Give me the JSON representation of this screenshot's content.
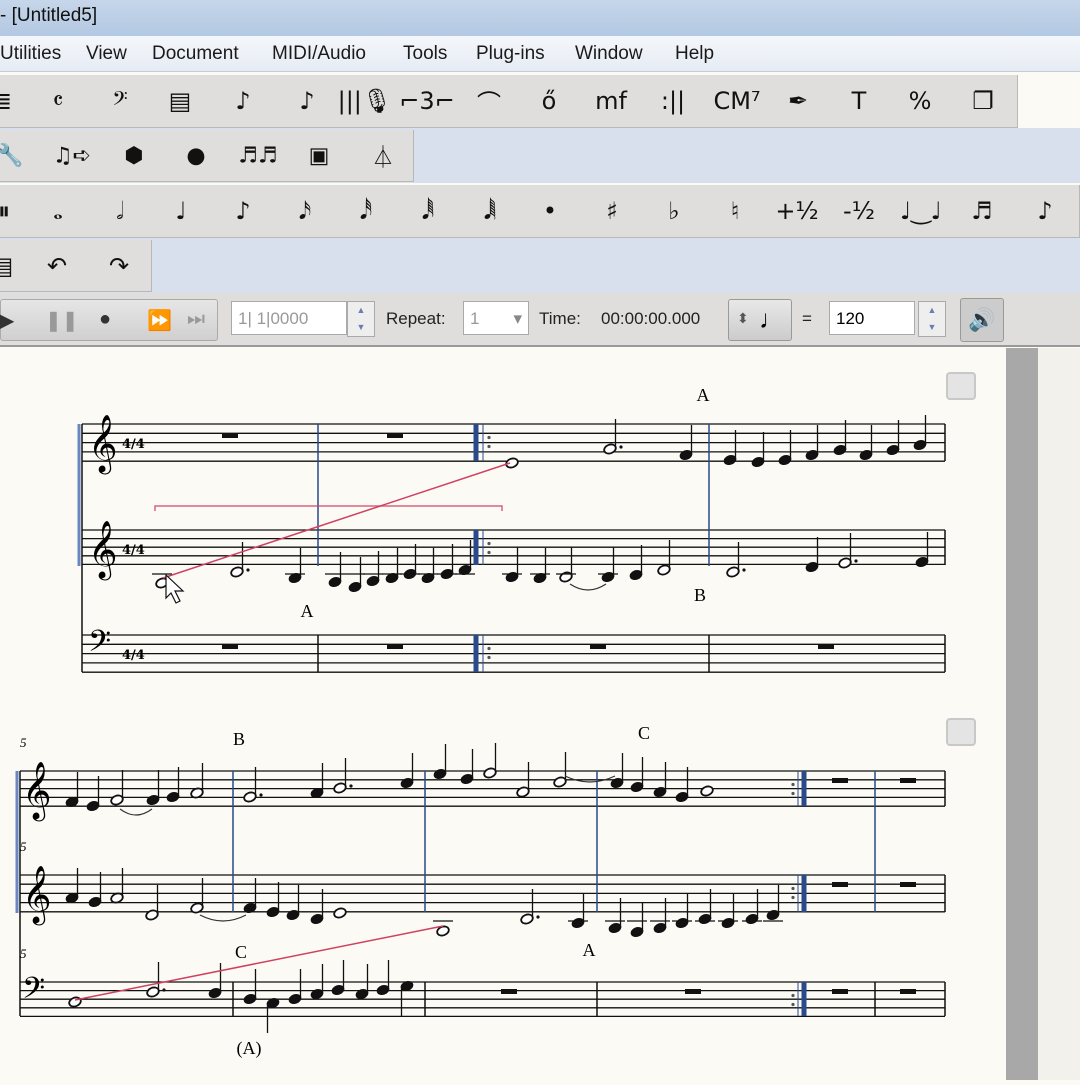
{
  "window": {
    "title": "- [Untitled5]"
  },
  "menu": [
    "Utilities",
    "View",
    "Document",
    "MIDI/Audio",
    "Tools",
    "Plug-ins",
    "Window",
    "Help"
  ],
  "toolbar_main": [
    {
      "name": "staff-tool-icon",
      "glyph": "≣"
    },
    {
      "name": "time-signature-icon",
      "glyph": "𝄴"
    },
    {
      "name": "clef-icon",
      "glyph": "𝄢"
    },
    {
      "name": "measure-tool-icon",
      "glyph": "▤"
    },
    {
      "name": "simple-entry-icon",
      "glyph": "♪"
    },
    {
      "name": "speedy-entry-icon",
      "glyph": "♪"
    },
    {
      "name": "hyperscribe-icon",
      "glyph": "|||🎙"
    },
    {
      "name": "tuplet-icon",
      "glyph": "⌐3⌐"
    },
    {
      "name": "smart-shape-icon",
      "glyph": "⌒"
    },
    {
      "name": "articulation-icon",
      "glyph": "ő"
    },
    {
      "name": "expression-icon",
      "glyph": "mf"
    },
    {
      "name": "repeat-icon",
      "glyph": ":||"
    },
    {
      "name": "chord-icon",
      "glyph": "CM⁷"
    },
    {
      "name": "lyrics-icon",
      "glyph": "✒"
    },
    {
      "name": "text-tool-icon",
      "glyph": "T"
    },
    {
      "name": "resize-icon",
      "glyph": "%"
    },
    {
      "name": "page-layout-icon",
      "glyph": "❐"
    }
  ],
  "toolbar_second": [
    {
      "name": "wrench-icon",
      "glyph": "🔧"
    },
    {
      "name": "mirror-icon",
      "glyph": "♫➪"
    },
    {
      "name": "special-tools-icon",
      "glyph": "⬢"
    },
    {
      "name": "midi-icon",
      "glyph": "●"
    },
    {
      "name": "mass-edit-icon",
      "glyph": "♬♬"
    },
    {
      "name": "graphics-icon",
      "glyph": "▣"
    },
    {
      "name": "metronome-icon",
      "glyph": "⏃"
    }
  ],
  "toolbar_notes": [
    {
      "name": "rest-toggle-icon",
      "glyph": "⏸"
    },
    {
      "name": "whole-note-icon",
      "glyph": "𝅝"
    },
    {
      "name": "half-note-icon",
      "glyph": "𝅗𝅥"
    },
    {
      "name": "quarter-note-icon",
      "glyph": "♩"
    },
    {
      "name": "eighth-note-icon",
      "glyph": "♪"
    },
    {
      "name": "sixteenth-note-icon",
      "glyph": "𝅘𝅥𝅯"
    },
    {
      "name": "thirty-second-note-icon",
      "glyph": "𝅘𝅥𝅰"
    },
    {
      "name": "sixty-fourth-note-icon",
      "glyph": "𝅘𝅥𝅱"
    },
    {
      "name": "128th-note-icon",
      "glyph": "𝅘𝅥𝅲"
    },
    {
      "name": "dot-icon",
      "glyph": "•"
    },
    {
      "name": "sharp-icon",
      "glyph": "♯"
    },
    {
      "name": "flat-icon",
      "glyph": "♭"
    },
    {
      "name": "natural-icon",
      "glyph": "♮"
    },
    {
      "name": "raise-half-step-icon",
      "glyph": "+½"
    },
    {
      "name": "lower-half-step-icon",
      "glyph": "-½"
    },
    {
      "name": "tie-icon",
      "glyph": "♩‿♩"
    },
    {
      "name": "tuplet-entry-icon",
      "glyph": "♬"
    },
    {
      "name": "grace-note-icon",
      "glyph": "♪"
    }
  ],
  "toolbar_edit": [
    {
      "name": "save-icon",
      "glyph": "▤"
    },
    {
      "name": "undo-icon",
      "glyph": "↶"
    },
    {
      "name": "redo-icon",
      "glyph": "↷"
    }
  ],
  "playback": {
    "buttons": [
      {
        "name": "play-icon",
        "glyph": "▶"
      },
      {
        "name": "pause-icon",
        "glyph": "❚❚"
      },
      {
        "name": "record-icon",
        "glyph": "●"
      },
      {
        "name": "fast-forward-icon",
        "glyph": "⏩"
      },
      {
        "name": "skip-end-icon",
        "glyph": "⏭"
      }
    ],
    "position": "1| 1|0000",
    "repeat_label": "Repeat:",
    "repeat_value": "1",
    "time_label": "Time:",
    "time_value": "00:00:00.000",
    "tempo_note": "♩",
    "equals": "=",
    "tempo": "120",
    "speaker_glyph": "🔊"
  },
  "score": {
    "rehearsal_marks": [
      "A",
      "A",
      "B",
      "B",
      "C",
      "C",
      "A",
      "(A)"
    ],
    "measure_number": "5",
    "time_signature": "4/4",
    "clefs": {
      "treble": "𝄞",
      "bass": "𝄢"
    },
    "accent_color": "#2b4a8c",
    "selection_color": "#d04060"
  }
}
